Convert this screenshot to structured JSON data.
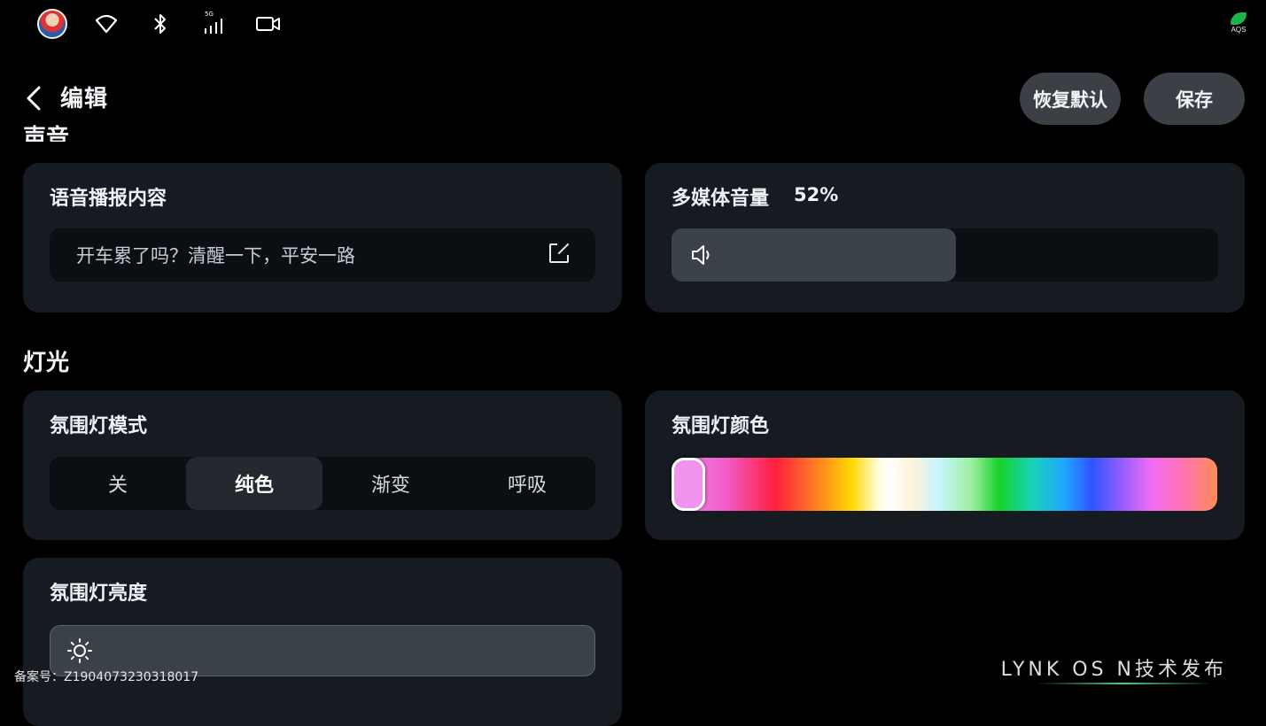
{
  "status_bar": {
    "icons": [
      "avatar",
      "wifi-icon",
      "bluetooth-icon",
      "cellular-5g-icon",
      "camera-icon"
    ],
    "signal_label": "5G",
    "aqs_label": "AQS"
  },
  "header": {
    "title": "编辑",
    "restore_label": "恢复默认",
    "save_label": "保存"
  },
  "sections": {
    "sound_title": "声音",
    "light_title": "灯光"
  },
  "voice": {
    "label": "语音播报内容",
    "text": "开车累了吗？清醒一下，平安一路"
  },
  "media_volume": {
    "label": "多媒体音量",
    "percent_text": "52%",
    "value": 0.52
  },
  "ambient_mode": {
    "label": "氛围灯模式",
    "options": [
      "关",
      "纯色",
      "渐变",
      "呼吸"
    ],
    "selected": "纯色"
  },
  "ambient_color": {
    "label": "氛围灯颜色",
    "selected_color": "#f08ff0"
  },
  "ambient_brightness": {
    "label": "氛围灯亮度",
    "value": 1.0
  },
  "footer": {
    "beian": "备案号：Z1904073230318017",
    "brand": "LYNK OS N技术发布"
  },
  "colors": {
    "card_bg": "#161b21",
    "button_bg": "#3a4046",
    "accent_green": "#3fd28c"
  }
}
